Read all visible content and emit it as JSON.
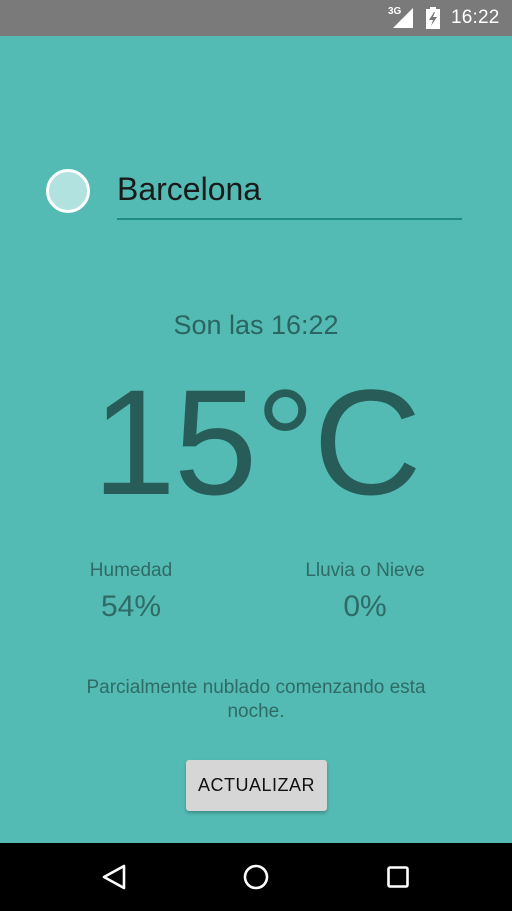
{
  "status_bar": {
    "network": "3G",
    "time": "16:22"
  },
  "location": {
    "city_value": "Barcelona"
  },
  "weather": {
    "time_text": "Son las 16:22",
    "temperature": "15°C",
    "humidity_label": "Humedad",
    "humidity_value": "54%",
    "precip_label": "Lluvia o Nieve",
    "precip_value": "0%",
    "summary": "Parcialmente nublado comenzando esta noche."
  },
  "actions": {
    "refresh_label": "ACTUALIZAR"
  },
  "nav_bar": {
    "icons": [
      "back-icon",
      "home-icon",
      "recent-apps-icon"
    ]
  },
  "colors": {
    "background": "#53bbb3",
    "status_bar": "#7a7a7a",
    "text_dark": "#275c59",
    "button": "#d6d6d6",
    "nav_bar": "#000000"
  }
}
